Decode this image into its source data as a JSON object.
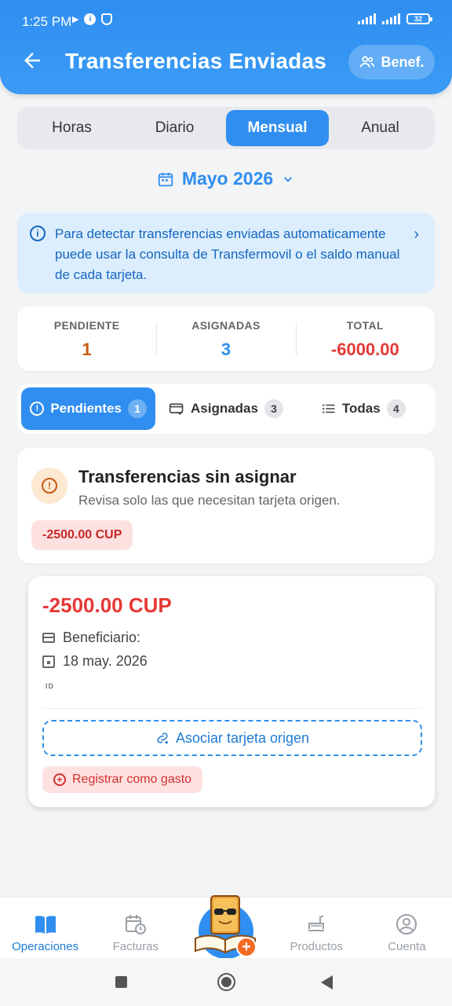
{
  "status_bar": {
    "time": "1:25 PM",
    "battery": "32"
  },
  "header": {
    "title": "Transferencias Enviadas",
    "benef_label": "Benef."
  },
  "period_tabs": [
    {
      "label": "Horas",
      "active": false
    },
    {
      "label": "Diario",
      "active": false
    },
    {
      "label": "Mensual",
      "active": true
    },
    {
      "label": "Anual",
      "active": false
    }
  ],
  "month_selector": {
    "label": "Mayo 2026"
  },
  "info_banner": {
    "text": "Para detectar transferencias enviadas automaticamente puede usar la consulta de Transfermovil o el saldo manual de cada tarjeta."
  },
  "stats": {
    "pending": {
      "label": "PENDIENTE",
      "value": "1",
      "color": "#c65a12"
    },
    "assigned": {
      "label": "ASIGNADAS",
      "value": "3",
      "color": "#2f8ef0"
    },
    "total": {
      "label": "TOTAL",
      "value": "-6000.00",
      "color": "#e53935"
    }
  },
  "filters": [
    {
      "label": "Pendientes",
      "count": "1",
      "active": true
    },
    {
      "label": "Asignadas",
      "count": "3",
      "active": false
    },
    {
      "label": "Todas",
      "count": "4",
      "active": false
    }
  ],
  "unassigned": {
    "title": "Transferencias sin asignar",
    "subtitle": "Revisa solo las que necesitan tarjeta origen.",
    "chip": "-2500.00 CUP"
  },
  "transfer": {
    "amount": "-2500.00 CUP",
    "beneficiary_label": "Beneficiario:",
    "date": "18 may. 2026",
    "id_tag": "ID",
    "associate_label": "Asociar tarjeta origen",
    "register_label": "Registrar como gasto"
  },
  "bottom_nav": [
    {
      "label": "Operaciones",
      "active": true
    },
    {
      "label": "Facturas",
      "active": false
    },
    {
      "label": "Productos",
      "active": false
    },
    {
      "label": "Cuenta",
      "active": false
    }
  ],
  "colors": {
    "accent": "#2f8ef0",
    "danger": "#e53935",
    "warning": "#c65a12"
  }
}
